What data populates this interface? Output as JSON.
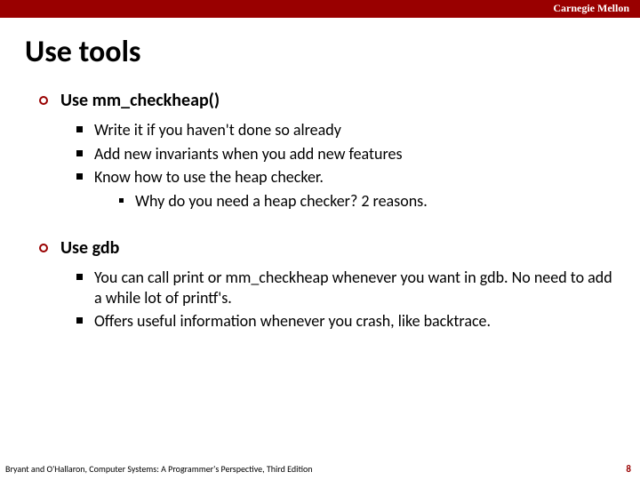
{
  "header": {
    "brand": "Carnegie Mellon"
  },
  "title": "Use tools",
  "sections": [
    {
      "heading": "Use mm_checkheap()",
      "items": [
        {
          "text": "Write it if you haven't done so already"
        },
        {
          "text": "Add new invariants when you add new features"
        },
        {
          "text": "Know how to use the heap checker.",
          "subitems": [
            {
              "text": "Why do you need a heap checker? 2 reasons."
            }
          ]
        }
      ]
    },
    {
      "heading": "Use gdb",
      "items": [
        {
          "text": "You can call print or mm_checkheap whenever you want in gdb. No need to add a while lot of printf's."
        },
        {
          "text": "Offers useful information whenever you crash, like backtrace."
        }
      ]
    }
  ],
  "footer": {
    "credit": "Bryant and O'Hallaron, Computer Systems: A Programmer's Perspective, Third Edition",
    "page": "8"
  }
}
